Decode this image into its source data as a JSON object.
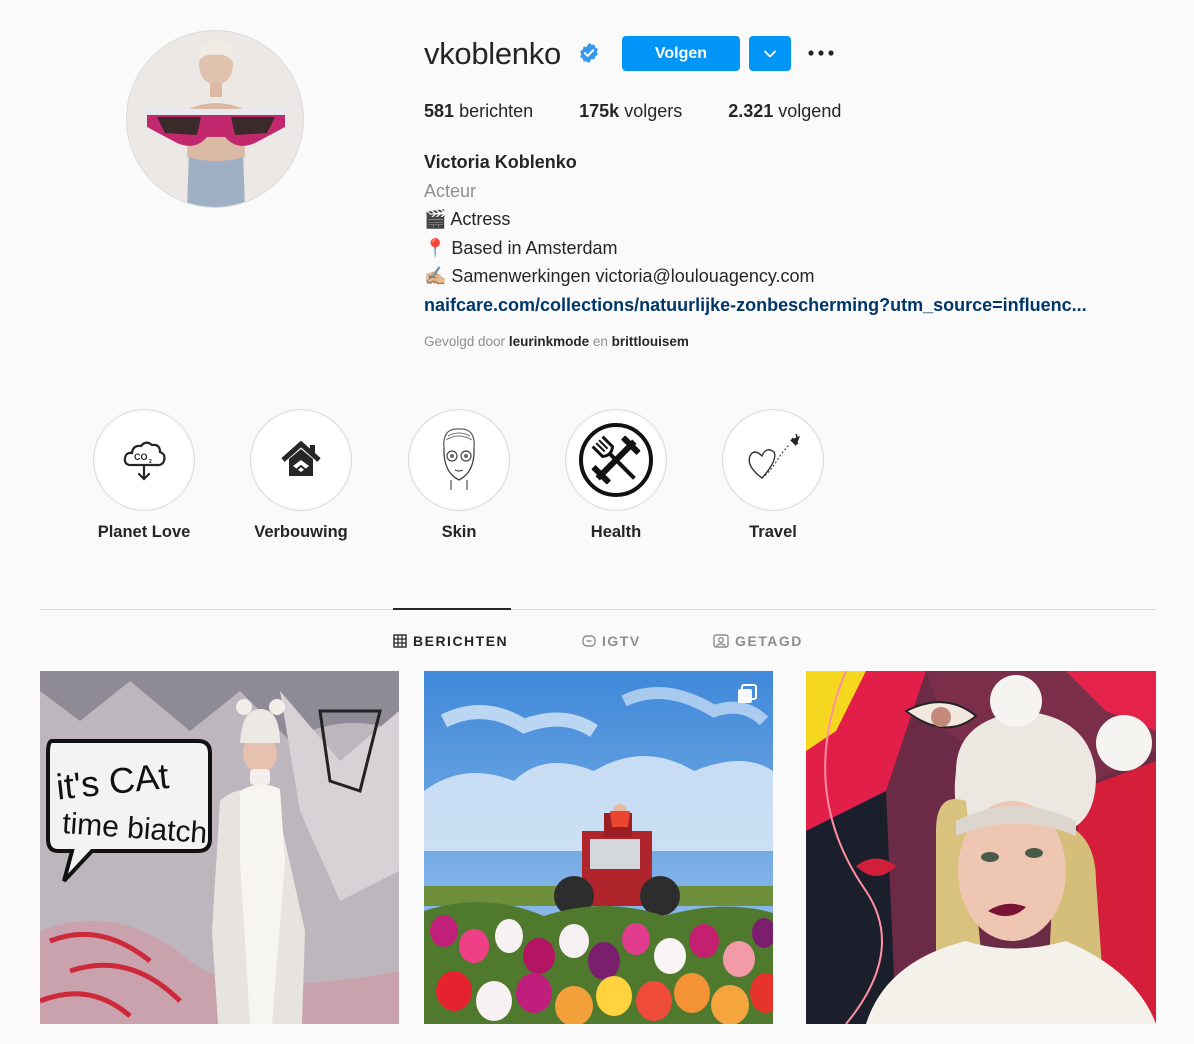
{
  "profile": {
    "username": "vkoblenko",
    "follow_label": "Volgen",
    "stats": [
      {
        "value": "581",
        "label": "berichten"
      },
      {
        "value": "175k",
        "label": "volgers"
      },
      {
        "value": "2.321",
        "label": "volgend"
      }
    ],
    "full_name": "Victoria Koblenko",
    "category": "Acteur",
    "bio_lines": [
      "🎬 Actress",
      "📍 Based in Amsterdam",
      "✍🏼 Samenwerkingen victoria@loulouagency.com"
    ],
    "link": "naifcare.com/collections/natuurlijke-zonbescherming?utm_source=influenc...",
    "followed_by": {
      "prefix": "Gevolgd door",
      "user1": "leurinkmode",
      "conj": "en",
      "user2": "brittlouisem"
    }
  },
  "highlights": [
    {
      "label": "Planet Love",
      "icon": "co2-cloud-icon"
    },
    {
      "label": "Verbouwing",
      "icon": "house-icon"
    },
    {
      "label": "Skin",
      "icon": "face-mask-icon"
    },
    {
      "label": "Health",
      "icon": "fork-dumbbell-icon"
    },
    {
      "label": "Travel",
      "icon": "heart-plane-icon"
    }
  ],
  "tabs": [
    {
      "label": "BERICHTEN",
      "icon": "grid-icon",
      "active": true
    },
    {
      "label": "IGTV",
      "icon": "igtv-icon",
      "active": false
    },
    {
      "label": "GETAGD",
      "icon": "tagged-icon",
      "active": false
    }
  ],
  "posts": [
    {
      "graffiti_line1": "it's CAt",
      "graffiti_line2": "time biatch"
    },
    {
      "carousel": true
    },
    {}
  ],
  "colors": {
    "accent": "#0095f6",
    "link": "#00376b",
    "muted": "#8e8e8e",
    "text": "#262626"
  }
}
